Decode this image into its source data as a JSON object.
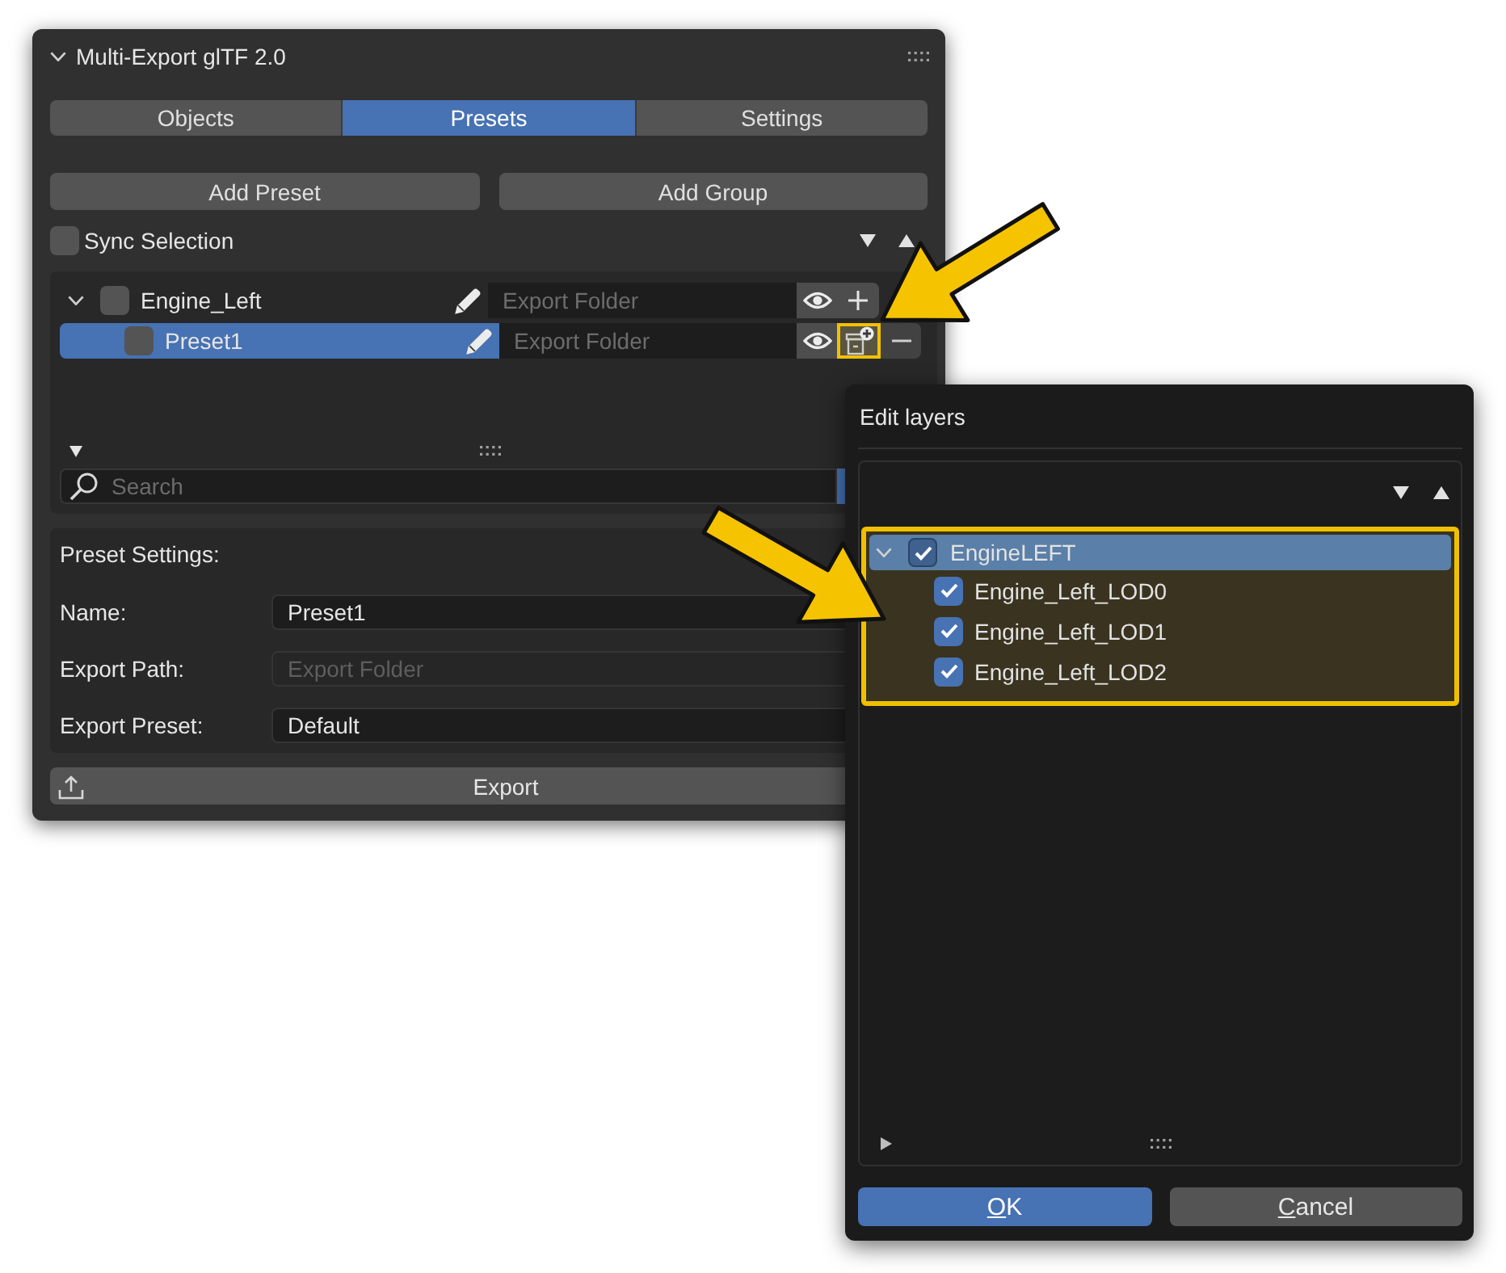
{
  "panel": {
    "title": "Multi-Export glTF 2.0",
    "expanded": true
  },
  "tabs": [
    {
      "label": "Objects",
      "selected": false
    },
    {
      "label": "Presets",
      "selected": true
    },
    {
      "label": "Settings",
      "selected": false
    }
  ],
  "add_buttons": [
    "Add Preset",
    "Add Group"
  ],
  "sync_selection": {
    "label": "Sync Selection",
    "checked": false
  },
  "preset_list": {
    "items": [
      {
        "kind": "group",
        "name": "Engine_Left",
        "expanded": true,
        "checked": false,
        "selected": false,
        "folder": {
          "placeholder": "Export Folder"
        },
        "buttons": [
          {
            "kind": "visibility",
            "highlighted": false
          },
          {
            "kind": "add",
            "highlighted": false
          }
        ],
        "children": [
          {
            "kind": "preset",
            "name": "Preset1",
            "checked": false,
            "selected": true,
            "folder": {
              "placeholder": "Export Folder"
            },
            "buttons": [
              {
                "kind": "visibility",
                "highlighted": false
              },
              {
                "kind": "edit_layers",
                "highlighted": true
              },
              {
                "kind": "remove",
                "highlighted": false
              }
            ]
          }
        ]
      }
    ],
    "filter_options_expanded": true,
    "search": {
      "placeholder": "Search"
    }
  },
  "preset_settings": {
    "heading": "Preset Settings:",
    "fields": [
      {
        "label": "Name:",
        "value": "Preset1"
      },
      {
        "label": "Export Path:",
        "placeholder": "Export Folder"
      },
      {
        "label": "Export Preset:",
        "value": "Default"
      }
    ]
  },
  "export_button": {
    "label": "Export"
  },
  "edit_layers_dialog": {
    "title": "Edit layers",
    "highlighted": true,
    "tree": [
      {
        "name": "EngineLEFT",
        "checked": true,
        "expanded": true,
        "selected": true,
        "children": [
          {
            "name": "Engine_Left_LOD0",
            "checked": true,
            "selected": false
          },
          {
            "name": "Engine_Left_LOD1",
            "checked": true,
            "selected": false
          },
          {
            "name": "Engine_Left_LOD2",
            "checked": true,
            "selected": false
          }
        ]
      }
    ],
    "filter_options_expanded": false,
    "buttons": [
      {
        "label": "OK",
        "kind": "primary"
      },
      {
        "label": "Cancel",
        "kind": "secondary"
      }
    ]
  }
}
